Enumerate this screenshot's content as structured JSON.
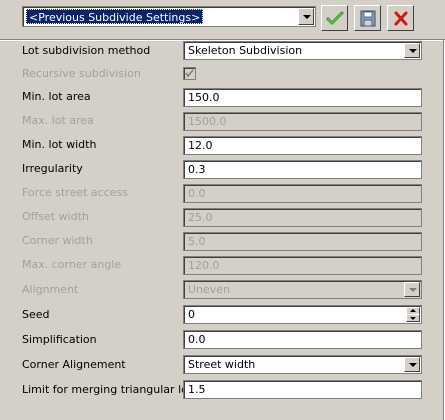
{
  "preset": {
    "value": "<Previous Subdivide Settings>"
  },
  "toolbar": {
    "apply_icon": "green-check-icon",
    "save_icon": "floppy-disk-icon",
    "delete_icon": "red-x-icon"
  },
  "colors": {
    "selection": "#0a246a",
    "apply": "#3a9a2a",
    "delete": "#cc1a1a"
  },
  "params": {
    "method": {
      "label": "Lot subdivision method",
      "value": "Skeleton Subdivision"
    },
    "recursive": {
      "label": "Recursive subdivision",
      "checked": true
    },
    "min_area": {
      "label": "Min. lot area",
      "value": "150.0"
    },
    "max_area": {
      "label": "Max. lot area",
      "value": "1500.0"
    },
    "min_width": {
      "label": "Min. lot width",
      "value": "12.0"
    },
    "irregularity": {
      "label": "Irregularity",
      "value": "0.3"
    },
    "force_street": {
      "label": "Force street access",
      "value": "0.0"
    },
    "offset_width": {
      "label": "Offset width",
      "value": "25.0"
    },
    "corner_width": {
      "label": "Corner width",
      "value": "5.0"
    },
    "max_corner_angle": {
      "label": "Max. corner angle",
      "value": "120.0"
    },
    "alignment": {
      "label": "Alignment",
      "value": "Uneven"
    },
    "seed": {
      "label": "Seed",
      "value": "0"
    },
    "simplification": {
      "label": "Simplification",
      "value": "0.0"
    },
    "corner_alignment": {
      "label": "Corner Alignement",
      "value": "Street width"
    },
    "merge_limit": {
      "label": "Limit for merging triangular lots",
      "value": "1.5"
    }
  }
}
